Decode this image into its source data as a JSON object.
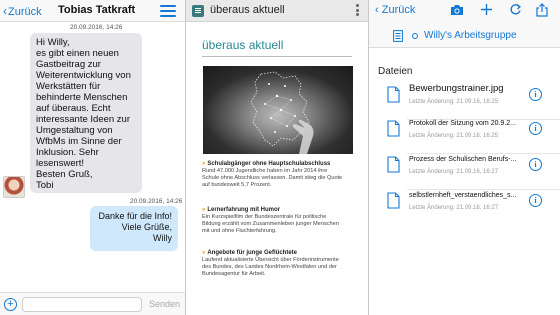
{
  "chat": {
    "back_label": "Zurück",
    "title": "Tobias Tatkraft",
    "incoming": {
      "timestamp": "20.09.2016, 14:26",
      "lines": [
        "Hi Willy,",
        "es gibt einen neuen",
        "Gastbeitrag zur",
        "Weiterentwicklung von",
        "Werkstätten für",
        "behinderte Menschen",
        "auf überaus. Echt",
        "interessante Ideen zur",
        "Umgestaltung von",
        "WfbMs im Sinne der",
        "Inklusion.  Sehr",
        "lesenswert!",
        "Besten Gruß,",
        "Tobi"
      ]
    },
    "outgoing": {
      "timestamp": "20.09.2016, 14:26",
      "lines": [
        "Danke für die Info!",
        "Viele Grüße,",
        "Willy"
      ]
    },
    "input_value": "",
    "send_label": "Senden"
  },
  "article": {
    "app_title": "überaus aktuell",
    "heading": "überaus aktuell",
    "news": [
      {
        "title": "Schulabgänger ohne Hauptschulabschluss",
        "body": [
          "Rund 47.000 Jugendliche haben im Jahr 2014 ihre",
          "Schule ohne Abschluss verlassen. Damit stieg die Quote",
          "auf bundesweit 5,7 Prozent."
        ]
      },
      {
        "title": "Lernerfahrung mit Humor",
        "body": [
          "Ein Kurzspielfilm der Bundeszentrale für politische",
          "Bildung erzählt vom Zusammenleben junger Menschen",
          "mit und ohne Fluchterfahrung."
        ]
      },
      {
        "title": "Angebote für junge Geflüchtete",
        "body": [
          "Laufend aktualisierte Übersicht über Förderinstrumente",
          "des Bundes, des Landes Nordrhein-Westfalen und der",
          "Bundesagentur für Arbeit."
        ]
      }
    ]
  },
  "files": {
    "back_label": "Zurück",
    "group_name": "Willy's Arbeitsgruppe",
    "section_title": "Dateien",
    "items": [
      {
        "name": "Bewerbungstrainer.jpg",
        "date": "Letzte Änderung: 21.09.16, 16:25"
      },
      {
        "name": "Protokoll der Sitzung vom 20.9.2...",
        "date": "Letzte Änderung: 21.09.16, 16:25"
      },
      {
        "name": "Prozess der Schulischen Berufs-...",
        "date": "Letzte Änderung: 21.09.16, 16:27"
      },
      {
        "name": "selbstlernheft_verstaendliches_s...",
        "date": "Letzte Änderung: 21.09.16, 16:27"
      }
    ]
  }
}
